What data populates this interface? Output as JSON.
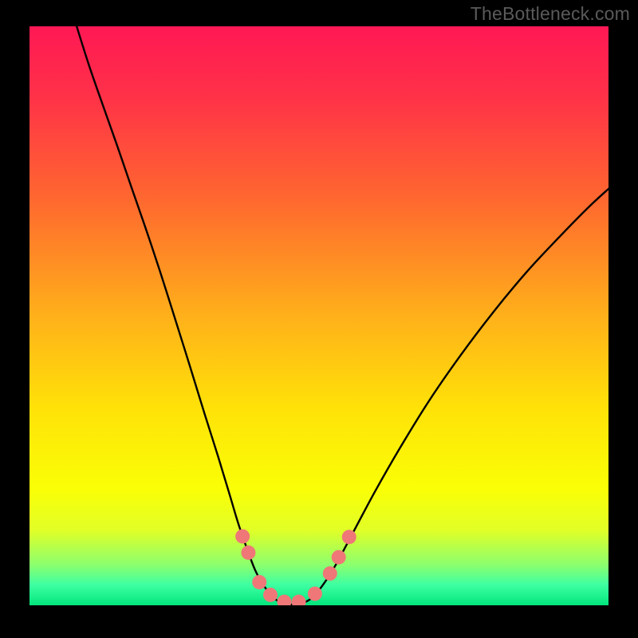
{
  "watermark": "TheBottleneck.com",
  "chart_data": {
    "type": "line",
    "title": "",
    "xlabel": "",
    "ylabel": "",
    "xlim": [
      0,
      1
    ],
    "ylim": [
      0,
      1
    ],
    "gradient_stops": [
      {
        "offset": 0.0,
        "color": "#ff1854"
      },
      {
        "offset": 0.12,
        "color": "#ff3148"
      },
      {
        "offset": 0.3,
        "color": "#ff682f"
      },
      {
        "offset": 0.5,
        "color": "#ffb01a"
      },
      {
        "offset": 0.66,
        "color": "#ffe208"
      },
      {
        "offset": 0.8,
        "color": "#faff06"
      },
      {
        "offset": 0.87,
        "color": "#e1ff27"
      },
      {
        "offset": 0.93,
        "color": "#8cff6e"
      },
      {
        "offset": 0.965,
        "color": "#3dffa2"
      },
      {
        "offset": 1.0,
        "color": "#02e57c"
      }
    ],
    "series": [
      {
        "name": "left-curve",
        "points": [
          {
            "x": 0.079,
            "y": 1.008
          },
          {
            "x": 0.102,
            "y": 0.935
          },
          {
            "x": 0.128,
            "y": 0.86
          },
          {
            "x": 0.151,
            "y": 0.795
          },
          {
            "x": 0.175,
            "y": 0.725
          },
          {
            "x": 0.2,
            "y": 0.653
          },
          {
            "x": 0.225,
            "y": 0.578
          },
          {
            "x": 0.252,
            "y": 0.493
          },
          {
            "x": 0.278,
            "y": 0.41
          },
          {
            "x": 0.302,
            "y": 0.332
          },
          {
            "x": 0.326,
            "y": 0.256
          },
          {
            "x": 0.346,
            "y": 0.19
          },
          {
            "x": 0.361,
            "y": 0.14
          },
          {
            "x": 0.377,
            "y": 0.094
          },
          {
            "x": 0.391,
            "y": 0.058
          },
          {
            "x": 0.406,
            "y": 0.032
          },
          {
            "x": 0.422,
            "y": 0.013
          },
          {
            "x": 0.436,
            "y": 0.004
          },
          {
            "x": 0.455,
            "y": 0.001
          }
        ]
      },
      {
        "name": "right-curve",
        "points": [
          {
            "x": 0.455,
            "y": 0.001
          },
          {
            "x": 0.472,
            "y": 0.004
          },
          {
            "x": 0.489,
            "y": 0.014
          },
          {
            "x": 0.508,
            "y": 0.037
          },
          {
            "x": 0.529,
            "y": 0.07
          },
          {
            "x": 0.559,
            "y": 0.126
          },
          {
            "x": 0.597,
            "y": 0.197
          },
          {
            "x": 0.64,
            "y": 0.272
          },
          {
            "x": 0.69,
            "y": 0.353
          },
          {
            "x": 0.744,
            "y": 0.431
          },
          {
            "x": 0.8,
            "y": 0.505
          },
          {
            "x": 0.858,
            "y": 0.575
          },
          {
            "x": 0.913,
            "y": 0.634
          },
          {
            "x": 0.965,
            "y": 0.687
          },
          {
            "x": 1.003,
            "y": 0.722
          }
        ]
      }
    ],
    "markers": [
      {
        "x": 0.368,
        "y": 0.119,
        "r": 9
      },
      {
        "x": 0.378,
        "y": 0.091,
        "r": 9
      },
      {
        "x": 0.397,
        "y": 0.04,
        "r": 9
      },
      {
        "x": 0.416,
        "y": 0.018,
        "r": 9
      },
      {
        "x": 0.44,
        "y": 0.006,
        "r": 9
      },
      {
        "x": 0.465,
        "y": 0.006,
        "r": 9
      },
      {
        "x": 0.493,
        "y": 0.02,
        "r": 9
      },
      {
        "x": 0.519,
        "y": 0.055,
        "r": 9
      },
      {
        "x": 0.534,
        "y": 0.083,
        "r": 9
      },
      {
        "x": 0.552,
        "y": 0.118,
        "r": 9
      }
    ],
    "marker_color": "#ef7777"
  }
}
